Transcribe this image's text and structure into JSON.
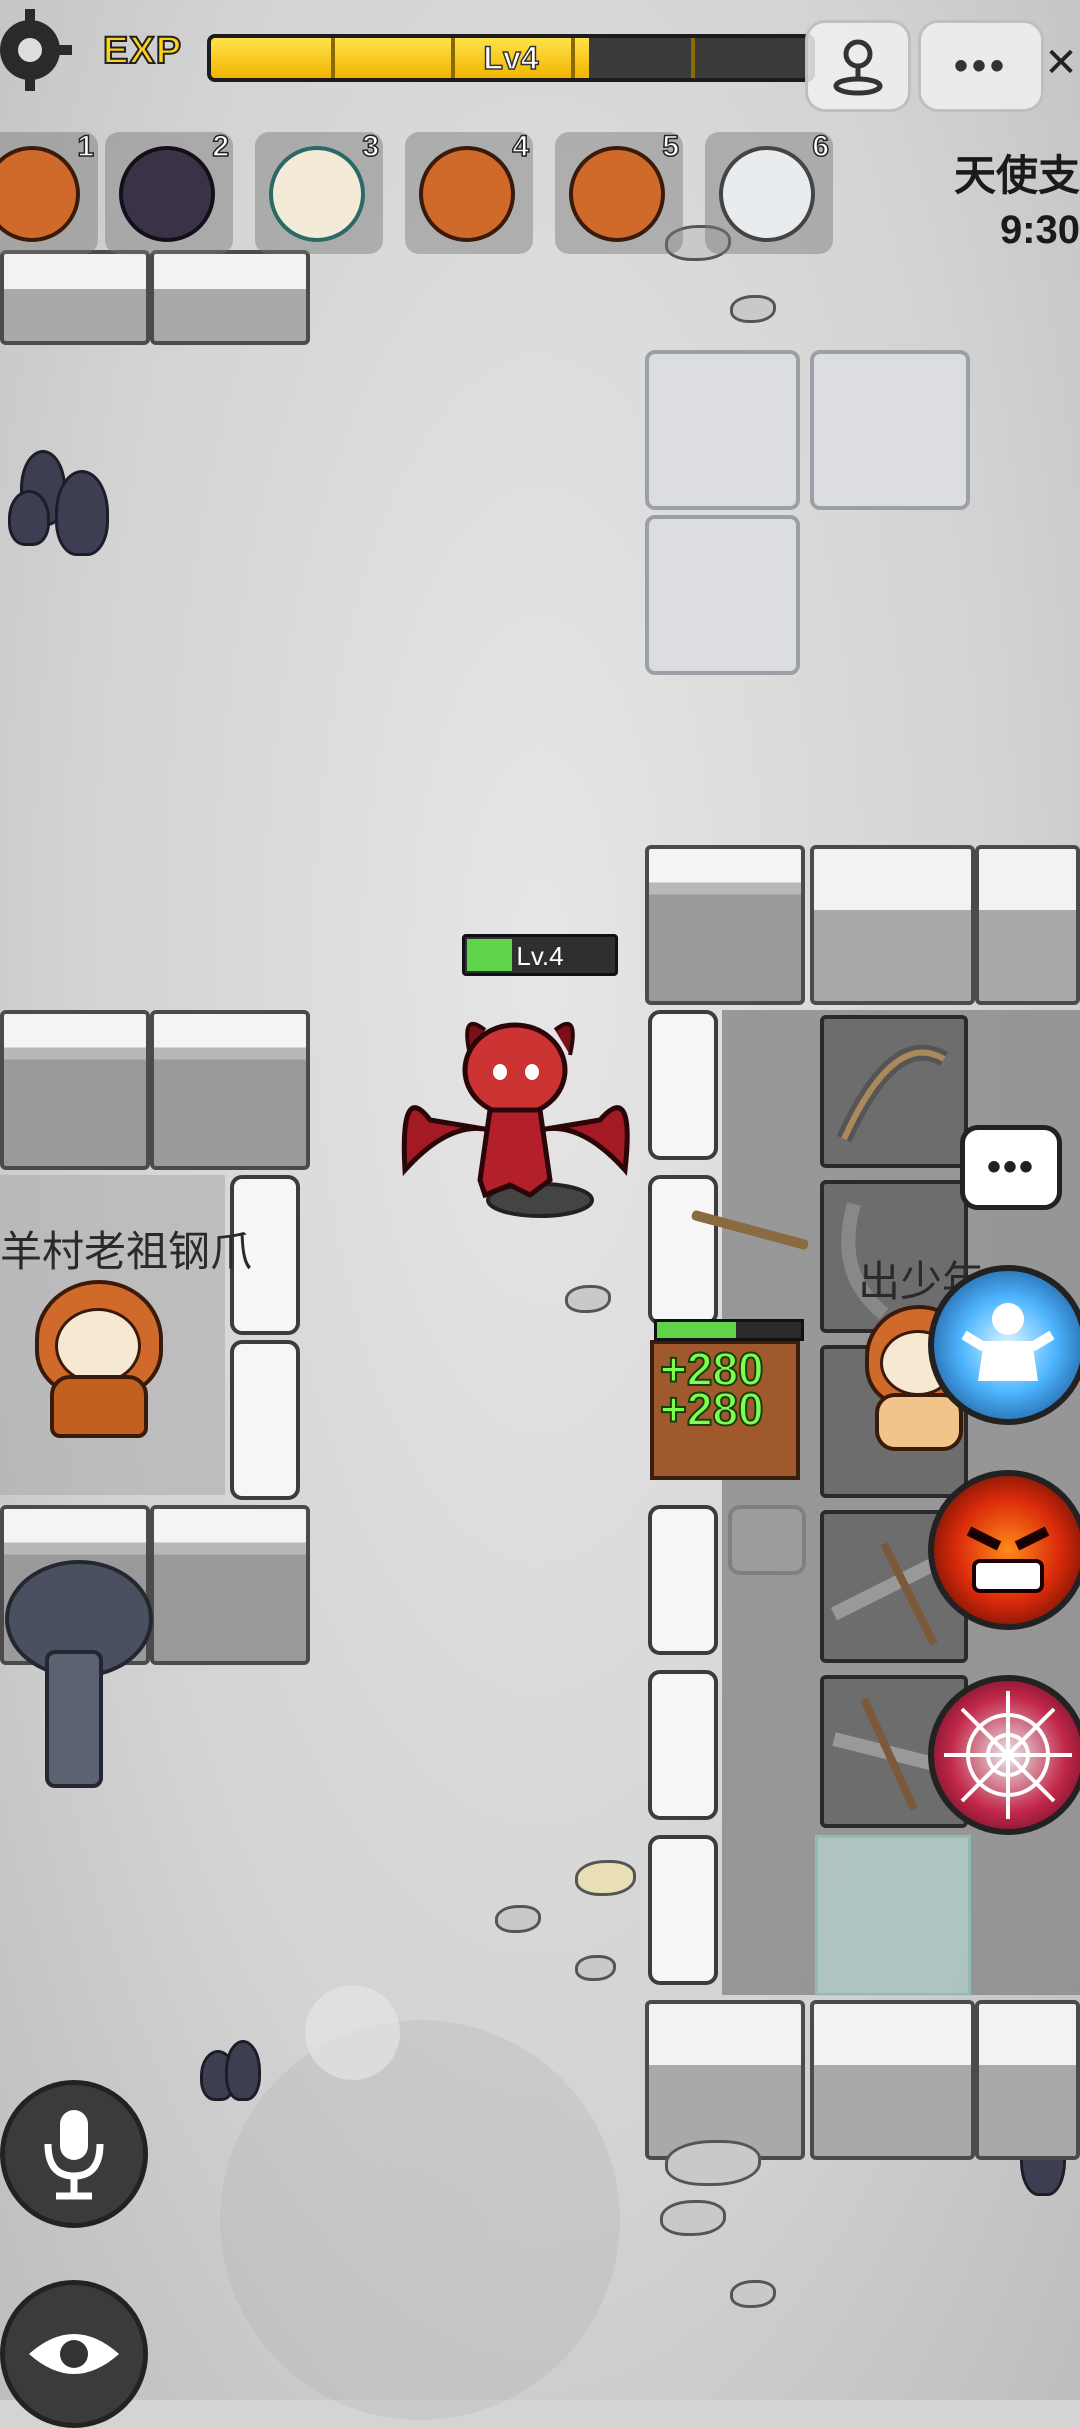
{
  "hud": {
    "exp_label": "EXP",
    "level_text": "Lv4",
    "exp_progress": 0.63,
    "settings_icon": "gear-icon",
    "joystick_icon": "joystick-icon",
    "more_icon": "more-dots-icon",
    "close_icon": "close-icon"
  },
  "party": [
    {
      "number": "1",
      "avatar": "orange-hood-sheep-icon"
    },
    {
      "number": "2",
      "avatar": "dark-sheep-icon"
    },
    {
      "number": "3",
      "avatar": "headphone-sheep-icon"
    },
    {
      "number": "4",
      "avatar": "orange-hood-sheep-icon"
    },
    {
      "number": "5",
      "avatar": "orange-hood-sheep-icon"
    },
    {
      "number": "6",
      "avatar": "astronaut-sheep-icon"
    }
  ],
  "status": {
    "team_name": "天使支",
    "time": "9:30"
  },
  "player": {
    "level": "Lv.4",
    "hp_fraction": 0.3
  },
  "npcs": [
    {
      "name": "羊村老祖钢爪"
    },
    {
      "name": "出少年"
    }
  ],
  "heal_popups": [
    "+280",
    "+280"
  ],
  "skills": [
    "power-up-skill-icon",
    "rage-face-skill-icon",
    "spider-web-skill-icon"
  ],
  "controls": {
    "mic_icon": "microphone-icon",
    "eye_icon": "eye-icon",
    "chat_icon": "speech-bubble-icon"
  },
  "colors": {
    "exp_fill": "#f2b400",
    "hp_fill": "#5fd34a",
    "heal_text": "#7dff4f",
    "demon_red": "#b3202a"
  }
}
